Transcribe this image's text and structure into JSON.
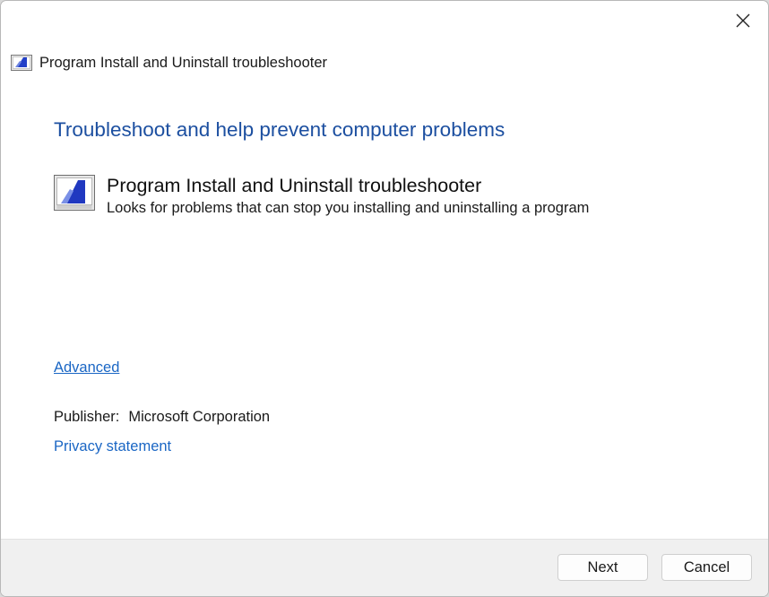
{
  "window": {
    "title": "Program Install and Uninstall troubleshooter"
  },
  "close_button": {
    "icon": "close-icon"
  },
  "main": {
    "heading": "Troubleshoot and help prevent computer problems",
    "troubleshooter": {
      "icon": "troubleshooter-icon",
      "name": "Program Install and Uninstall troubleshooter",
      "description": "Looks for problems that can stop you installing and uninstalling a program"
    },
    "advanced_link": "Advanced",
    "publisher_label": "Publisher:",
    "publisher_value": "Microsoft Corporation",
    "privacy_link": "Privacy statement"
  },
  "footer": {
    "next_label": "Next",
    "cancel_label": "Cancel"
  },
  "colors": {
    "heading": "#1c4fa0",
    "link": "#1a66c4",
    "footer_bg": "#f0f0f0"
  }
}
